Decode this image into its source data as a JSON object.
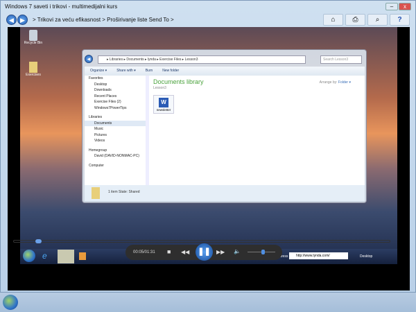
{
  "window": {
    "title": "Windows 7 saveti i trikovi - multimedijalni kurs",
    "breadcrumb": "> Trikovi za veću efikasnost  >  Proširivanje liste Send To >",
    "min": "–",
    "close": "x"
  },
  "nav_tools": [
    "home-icon",
    "print-icon",
    "search-icon",
    "help-icon"
  ],
  "desktop": {
    "icons": [
      "Recycle Bin",
      "Exercises"
    ]
  },
  "explorer": {
    "path": "▸ Libraries ▸ Documents ▸ lynda ▸ Exercise Files ▸ Lesson3",
    "search_placeholder": "Search Lesson3",
    "toolbar": [
      "Organize ▾",
      "Share with ▾",
      "Burn",
      "New folder"
    ],
    "nav": {
      "favorites": "Favorites",
      "fav_items": [
        "Desktop",
        "Downloads",
        "Recent Places",
        "Exercise Files (2)",
        "Windows7PowerTips"
      ],
      "libraries": "Libraries",
      "lib_items": [
        "Documents",
        "Music",
        "Pictures",
        "Videos"
      ],
      "homegroup": "Homegroup",
      "home_items": [
        "David (DAVID-NONMAC-PC)"
      ],
      "computer": "Computer"
    },
    "library_title": "Documents library",
    "library_sub": "Lesson3",
    "arrange_label": "Arrange by:",
    "arrange_value": "Folder ▾",
    "file": "newsletter",
    "status": "1 item  State:  Shared"
  },
  "inner_taskbar": {
    "address_label": "Address",
    "address_value": "http://www.lynda.com/",
    "desktop_label": "Desktop"
  },
  "player": {
    "time": "00:05/01:31",
    "progress": 0.055,
    "volume": 0.5
  }
}
